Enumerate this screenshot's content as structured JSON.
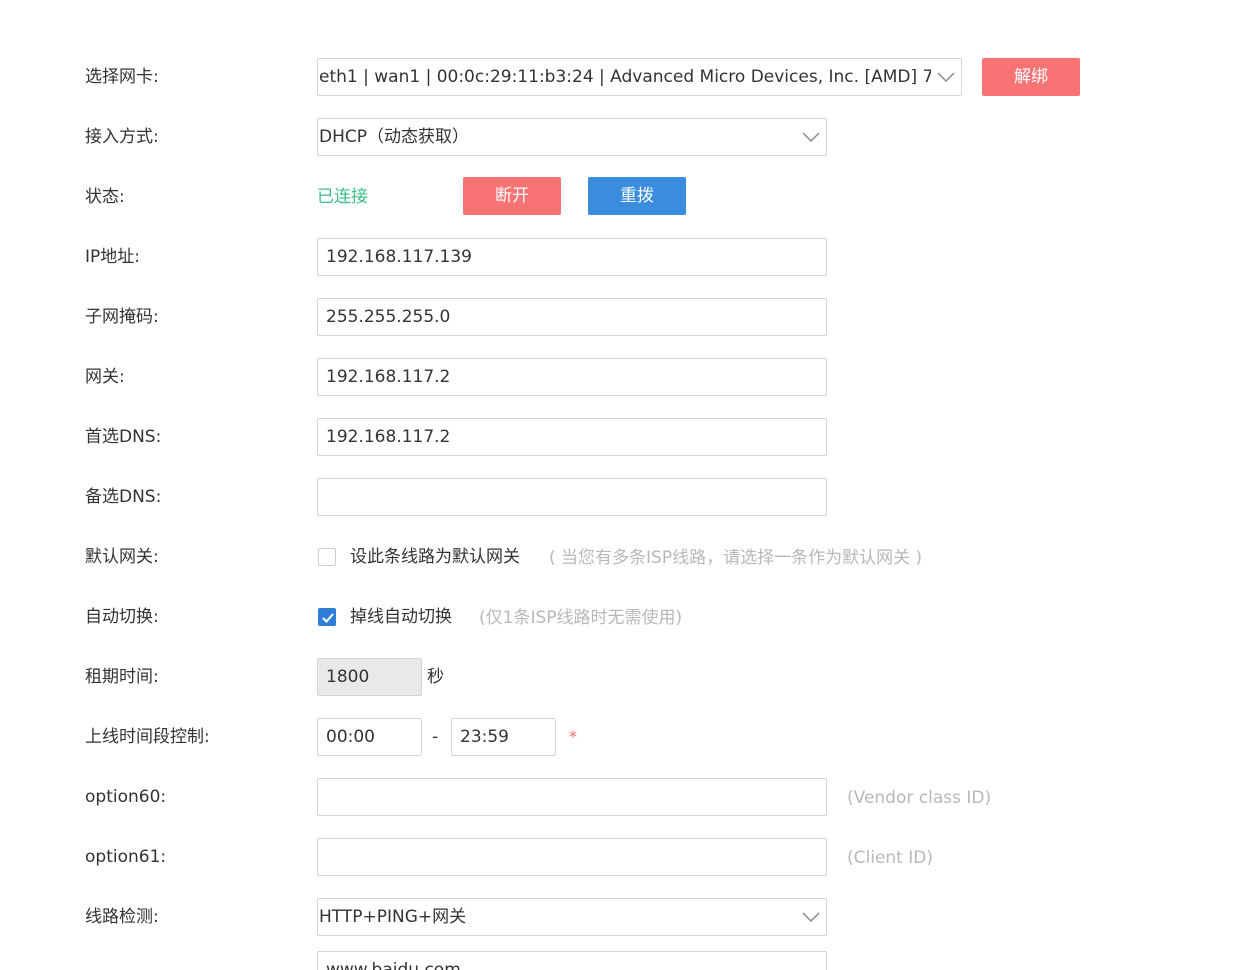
{
  "nic": {
    "label": "选择网卡:",
    "value": "eth1 | wan1 | 00:0c:29:11:b3:24 | Advanced Micro Devices, Inc. [AMD] 7",
    "unbind_label": "解绑"
  },
  "access": {
    "label": "接入方式:",
    "value": "DHCP（动态获取）"
  },
  "status": {
    "label": "状态:",
    "value": "已连接",
    "disconnect_label": "断开",
    "redial_label": "重拨"
  },
  "ip": {
    "label": "IP地址:",
    "value": "192.168.117.139"
  },
  "netmask": {
    "label": "子网掩码:",
    "value": "255.255.255.0"
  },
  "gateway": {
    "label": "网关:",
    "value": "192.168.117.2"
  },
  "dns1": {
    "label": "首选DNS:",
    "value": "192.168.117.2"
  },
  "dns2": {
    "label": "备选DNS:",
    "value": ""
  },
  "default_gw": {
    "label": "默认网关:",
    "checked": false,
    "option_label": "设此条线路为默认网关",
    "hint": "( 当您有多条ISP线路，请选择一条作为默认网关 )"
  },
  "auto_switch": {
    "label": "自动切换:",
    "checked": true,
    "option_label": "掉线自动切换",
    "hint": "(仅1条ISP线路时无需使用)"
  },
  "lease": {
    "label": "租期时间:",
    "value": "1800",
    "unit": "秒"
  },
  "online_time": {
    "label": "上线时间段控制:",
    "start": "00:00",
    "separator": "-",
    "end": "23:59",
    "required_mark": "*"
  },
  "option60": {
    "label": "option60:",
    "value": "",
    "hint": "(Vendor class ID)"
  },
  "option61": {
    "label": "option61:",
    "value": "",
    "hint": "(Client ID)"
  },
  "line_check": {
    "label": "线路检测:",
    "value": "HTTP+PING+网关"
  },
  "check_host": {
    "value": "www.baidu.com"
  },
  "colors": {
    "danger": "#f87474",
    "primary": "#3a8ddc",
    "success": "#3dbd8a",
    "hint": "#b8b8b8"
  }
}
